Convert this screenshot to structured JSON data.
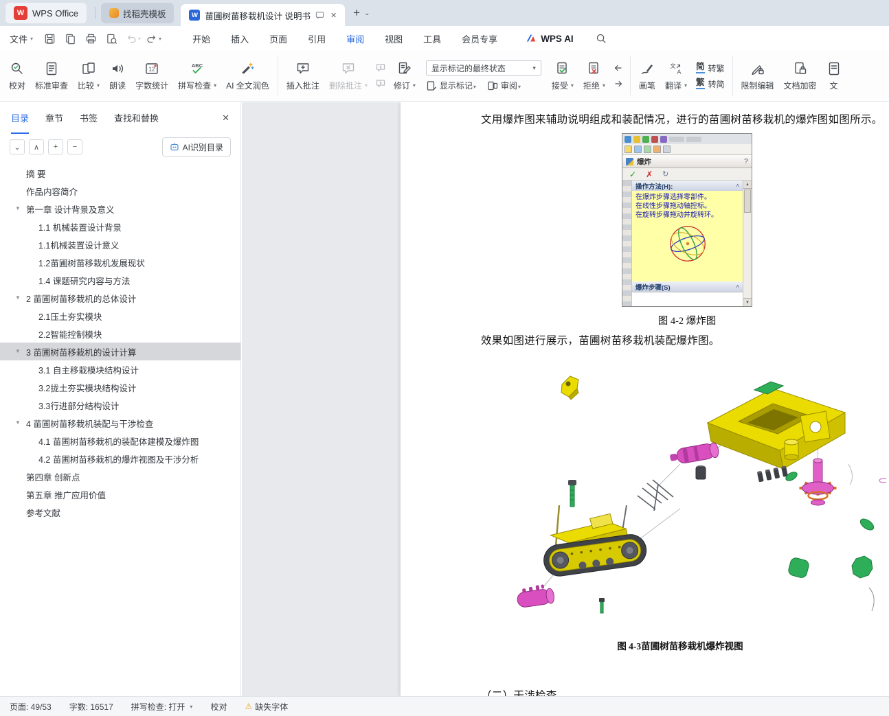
{
  "colors": {
    "accent": "#2e6be6",
    "wps_red": "#e33e38",
    "toc_selected_bg": "#d5d7da",
    "page_bg": "#e7e9ec"
  },
  "icons": {
    "close": "✕",
    "chevron_down": "⌄",
    "chevron_up": "∧",
    "plus": "+",
    "minus": "−",
    "check": "✓",
    "cross": "✗",
    "redo": "↻",
    "warning": "⚠",
    "up_arrow": "▲",
    "down_arrow": "▼",
    "help": "?",
    "toc_arrow": "▼",
    "collapse": "˄",
    "tab_plus": "+",
    "tab_caret": "⌄"
  },
  "tabbar": {
    "wps_home": "WPS Office",
    "template_tab": "找稻壳模板",
    "document_tab": "苗圃树苗移栽机设计 说明书"
  },
  "menubar": {
    "file": "文件",
    "tabs": [
      "开始",
      "插入",
      "页面",
      "引用",
      "审阅",
      "视图",
      "工具",
      "会员专享"
    ],
    "wps_ai": "WPS AI"
  },
  "ribbon": {
    "proofread": "校对",
    "standard_review": "标准审查",
    "compare": "比较",
    "read_aloud": "朗读",
    "word_count": "字数统计",
    "spell_check": "拼写检查",
    "ai_polish": "AI 全文润色",
    "insert_comment": "插入批注",
    "delete_comment": "删除批注",
    "revision": "修订",
    "markup_state": "显示标记的最终状态",
    "show_markup": "显示标记",
    "review_pane": "审阅",
    "accept": "接受",
    "reject": "拒绝",
    "ink": "画笔",
    "translate": "翻译",
    "s2t_prefix": "简",
    "s2t_label": "转繁",
    "t2s_prefix": "繁",
    "t2s_label": "转简",
    "restrict_edit": "限制编辑",
    "encrypt": "文档加密",
    "clipped_label": "文"
  },
  "sidebar": {
    "tabs": [
      "目录",
      "章节",
      "书签",
      "查找和替换"
    ],
    "ai_toc": "AI识别目录",
    "toc": [
      {
        "label": "摘  要",
        "level": 1
      },
      {
        "label": "作品内容简介",
        "level": 1
      },
      {
        "label": "第一章 设计背景及意义",
        "level": 1,
        "arrow": true
      },
      {
        "label": "1.1 机械装置设计背景",
        "level": 2
      },
      {
        "label": "1.1机械装置设计意义",
        "level": 2
      },
      {
        "label": "1.2苗圃树苗移栽机发展现状",
        "level": 2
      },
      {
        "label": "1.4 课题研究内容与方法",
        "level": 2
      },
      {
        "label": "2 苗圃树苗移栽机的总体设计",
        "level": 1,
        "arrow": true
      },
      {
        "label": "2.1压土夯实模块",
        "level": 2
      },
      {
        "label": "2.2智能控制模块",
        "level": 2
      },
      {
        "label": "3 苗圃树苗移栽机的设计计算",
        "level": 1,
        "arrow": true,
        "selected": true
      },
      {
        "label": "3.1 自主移栽模块结构设计",
        "level": 2
      },
      {
        "label": "3.2拢土夯实模块结构设计",
        "level": 2
      },
      {
        "label": "3.3行进部分结构设计",
        "level": 2
      },
      {
        "label": "4 苗圃树苗移栽机装配与干涉检查",
        "level": 1,
        "arrow": true
      },
      {
        "label": "4.1 苗圃树苗移栽机的装配体建模及爆炸图",
        "level": 2
      },
      {
        "label": "4.2 苗圃树苗移栽机的爆炸视图及干涉分析",
        "level": 2
      },
      {
        "label": "第四章 创新点",
        "level": 1
      },
      {
        "label": "第五章 推广应用价值",
        "level": 1
      },
      {
        "label": "参考文献",
        "level": 1
      }
    ]
  },
  "document": {
    "para1": "文用爆炸图来辅助说明组成和装配情况，进行的苗圃树苗移栽机的爆炸图如图所示。",
    "caption1": "图 4-2 爆炸图",
    "para2": "效果如图进行展示，苗圃树苗移栽机装配爆炸图。",
    "caption2": "图 4-3苗圃树苗移栽机爆炸视图",
    "para3": "（二）干涉检查",
    "sw_panel": {
      "title": "爆炸",
      "help_header": "操作方法(H):",
      "help_line1": "在爆炸步骤选择零部件。",
      "help_line2": "在线性步骤拖动轴控标。",
      "help_line3": "在旋转步骤拖动并旋转环。",
      "steps_header": "爆炸步骤(S)"
    }
  },
  "statusbar": {
    "page": "页面: 49/53",
    "words": "字数: 16517",
    "spell": "拼写检查: 打开",
    "proof": "校对",
    "missing_font": "缺失字体"
  }
}
